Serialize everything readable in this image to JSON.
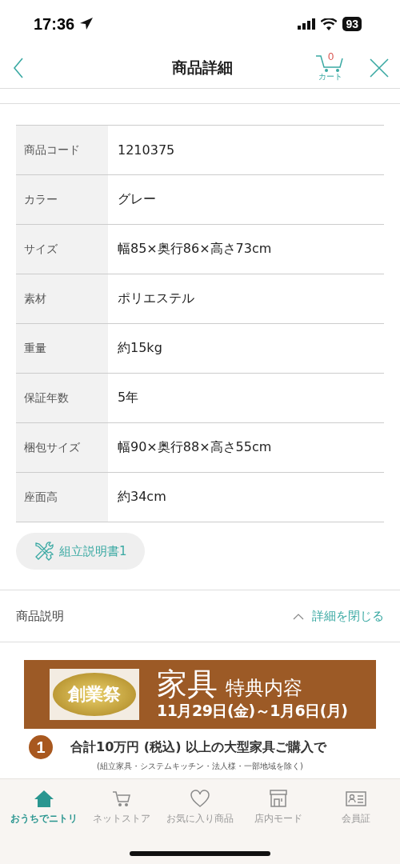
{
  "status_bar": {
    "time": "17:36",
    "battery": "93"
  },
  "header": {
    "title": "商品詳細",
    "cart_count": "0",
    "cart_label": "カート"
  },
  "specs": [
    {
      "label": "商品コード",
      "value": "1210375"
    },
    {
      "label": "カラー",
      "value": "グレー"
    },
    {
      "label": "サイズ",
      "value": "幅85×奥行86×高さ73cm"
    },
    {
      "label": "素材",
      "value": "ポリエステル"
    },
    {
      "label": "重量",
      "value": "約15kg"
    },
    {
      "label": "保証年数",
      "value": "5年"
    },
    {
      "label": "梱包サイズ",
      "value": "幅90×奥行88×高さ55cm"
    },
    {
      "label": "座面高",
      "value": "約34cm"
    }
  ],
  "manual_button": {
    "label": "組立説明書1"
  },
  "description": {
    "title": "商品説明",
    "toggle": "詳細を閉じる",
    "expanded": true
  },
  "banner": {
    "logo": "創業祭",
    "title": "家具",
    "subtitle": "特典内容",
    "dates": "11月29日(金)～1月6日(月)",
    "benefit_number": "1",
    "benefit": "合計**10**万円 (税込) 以上の大型家具ご購入で",
    "note": "(組立家具・システムキッチン・法人様・一部地域を除く)"
  },
  "tabs": [
    {
      "label": "おうちでニトリ",
      "selected": true
    },
    {
      "label": "ネットストア",
      "selected": false
    },
    {
      "label": "お気に入り商品",
      "selected": false
    },
    {
      "label": "店内モード",
      "selected": false
    },
    {
      "label": "会員証",
      "selected": false
    }
  ]
}
